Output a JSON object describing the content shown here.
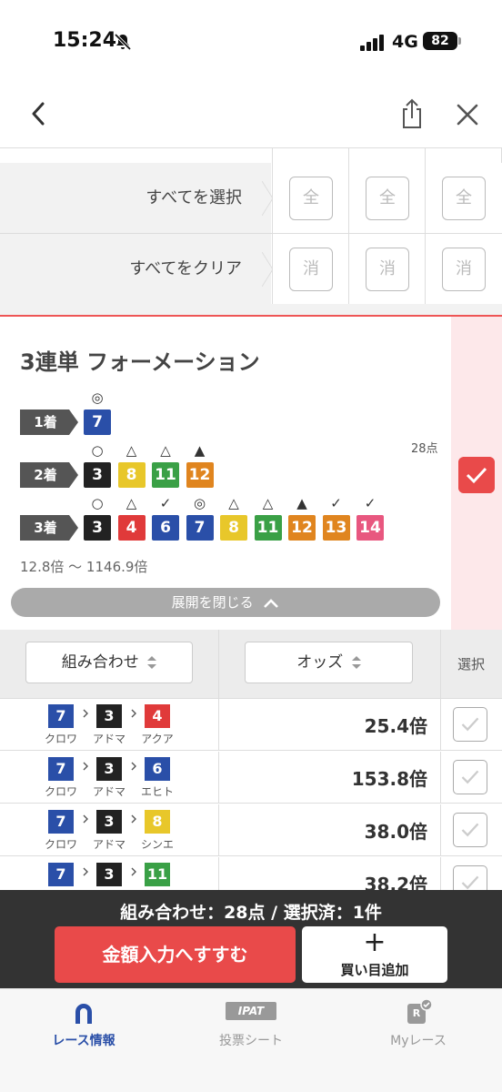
{
  "status_bar": {
    "time": "15:24",
    "network": "4G",
    "battery": "82"
  },
  "bulk_table": {
    "select_all_label": "すべてを選択",
    "select_all_buttons": [
      "全",
      "全",
      "全"
    ],
    "clear_all_label": "すべてをクリア",
    "clear_all_buttons": [
      "消",
      "消",
      "消"
    ]
  },
  "formation": {
    "title": "3連単 フォーメーション",
    "first": {
      "label": "1着",
      "horses": [
        {
          "num": "7",
          "mark": "◎",
          "color": "#2a4fa8"
        }
      ]
    },
    "second": {
      "label": "2着",
      "horses": [
        {
          "num": "3",
          "mark": "○",
          "color": "#222222"
        },
        {
          "num": "8",
          "mark": "△",
          "color": "#e8c72a"
        },
        {
          "num": "11",
          "mark": "△",
          "color": "#3aa046"
        },
        {
          "num": "12",
          "mark": "▲",
          "color": "#e0851f"
        }
      ]
    },
    "third": {
      "label": "3着",
      "horses": [
        {
          "num": "3",
          "mark": "○",
          "color": "#222222"
        },
        {
          "num": "4",
          "mark": "△",
          "color": "#e03a3a"
        },
        {
          "num": "6",
          "mark": "✓",
          "color": "#2a4fa8"
        },
        {
          "num": "7",
          "mark": "◎",
          "color": "#2a4fa8"
        },
        {
          "num": "8",
          "mark": "△",
          "color": "#e8c72a"
        },
        {
          "num": "11",
          "mark": "△",
          "color": "#3aa046"
        },
        {
          "num": "12",
          "mark": "▲",
          "color": "#e0851f"
        },
        {
          "num": "13",
          "mark": "✓",
          "color": "#e0851f"
        },
        {
          "num": "14",
          "mark": "✓",
          "color": "#e8577f"
        }
      ]
    },
    "points": "28点",
    "odds_range": "12.8倍 〜 1146.9倍",
    "collapse_label": "展開を閉じる"
  },
  "sort": {
    "combination_label": "組み合わせ",
    "odds_label": "オッズ",
    "select_label": "選択"
  },
  "rows": [
    {
      "horses": [
        {
          "num": "7",
          "name": "クロワ",
          "color": "#2a4fa8"
        },
        {
          "num": "3",
          "name": "アドマ",
          "color": "#222222"
        },
        {
          "num": "4",
          "name": "アクア",
          "color": "#e03a3a"
        }
      ],
      "odds": "25.4倍"
    },
    {
      "horses": [
        {
          "num": "7",
          "name": "クロワ",
          "color": "#2a4fa8"
        },
        {
          "num": "3",
          "name": "アドマ",
          "color": "#222222"
        },
        {
          "num": "6",
          "name": "エヒト",
          "color": "#2a4fa8"
        }
      ],
      "odds": "153.8倍"
    },
    {
      "horses": [
        {
          "num": "7",
          "name": "クロワ",
          "color": "#2a4fa8"
        },
        {
          "num": "3",
          "name": "アドマ",
          "color": "#222222"
        },
        {
          "num": "8",
          "name": "シンエ",
          "color": "#e8c72a"
        }
      ],
      "odds": "38.0倍"
    },
    {
      "horses": [
        {
          "num": "7",
          "name": "",
          "color": "#2a4fa8"
        },
        {
          "num": "3",
          "name": "",
          "color": "#222222"
        },
        {
          "num": "11",
          "name": "",
          "color": "#3aa046"
        }
      ],
      "odds": "38.2倍"
    }
  ],
  "bottom": {
    "summary": "組み合わせ：28点 / 選択済：1件",
    "amount_button": "金額入力へすすむ",
    "add_plus": "+",
    "add_label": "買い目追加"
  },
  "tabs": [
    {
      "label": "レース情報",
      "icon_text": "",
      "active": true
    },
    {
      "label": "投票シート",
      "icon_text": "IPAT",
      "active": false
    },
    {
      "label": "Myレース",
      "icon_text": "R",
      "active": false
    }
  ],
  "colors": {
    "accent": "#e94a4a",
    "tab_active": "#2a4fa8",
    "tab_inactive": "#999999"
  }
}
